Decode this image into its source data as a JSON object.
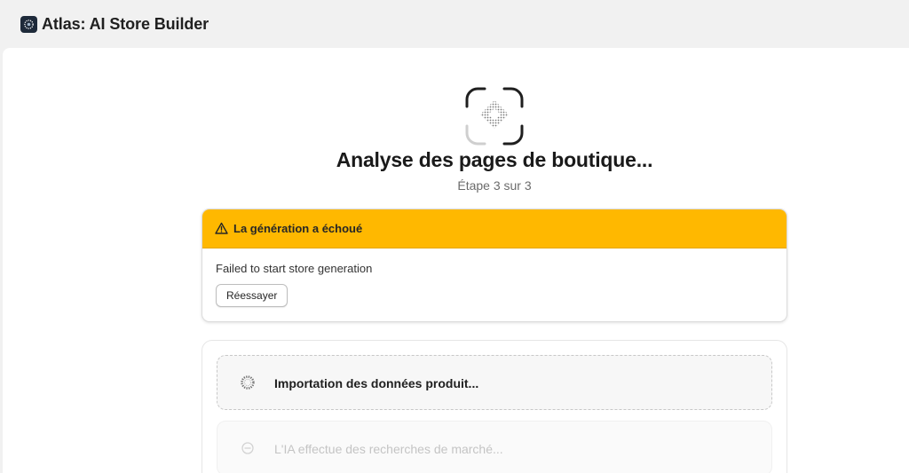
{
  "app": {
    "title": "Atlas: AI Store Builder",
    "logo_icon": "atlas-logo-icon"
  },
  "progress": {
    "headline": "Analyse des pages de boutique...",
    "step_text": "Étape 3 sur 3",
    "icon": "scan-frame-icon"
  },
  "error": {
    "title": "La génération a échoué",
    "message": "Failed to start store generation",
    "retry_label": "Réessayer",
    "icon": "warning-triangle-icon",
    "color": "#ffb800"
  },
  "tasks": [
    {
      "label": "Importation des données produit...",
      "status": "active",
      "icon": "spinner-icon"
    },
    {
      "label": "L'IA effectue des recherches de marché...",
      "status": "pending",
      "icon": "minus-circle-icon"
    }
  ]
}
